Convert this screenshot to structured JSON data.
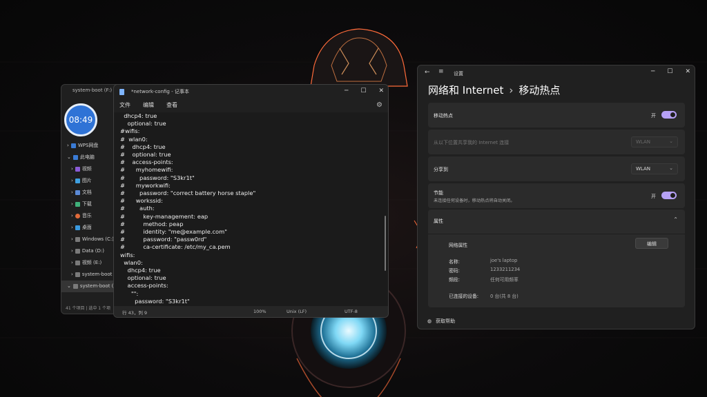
{
  "explorer": {
    "title": "system-boot (F:)",
    "nav_items": [
      {
        "label": "WPS网盘",
        "color": "#3a7bd5"
      },
      {
        "label": "此电脑",
        "color": "#3a7bd5"
      },
      {
        "label": "视频",
        "color": "#8a5bd6"
      },
      {
        "label": "图片",
        "color": "#3fa0e0"
      },
      {
        "label": "文档",
        "color": "#5b8ad6"
      },
      {
        "label": "下载",
        "color": "#3fb07a"
      },
      {
        "label": "音乐",
        "color": "#e06a3a"
      },
      {
        "label": "桌面",
        "color": "#3a9ae0"
      },
      {
        "label": "Windows (C:)",
        "color": "#7a7a7a"
      },
      {
        "label": "Data (D:)",
        "color": "#7a7a7a"
      },
      {
        "label": "视频 (E:)",
        "color": "#7a7a7a"
      },
      {
        "label": "system-boot (",
        "color": "#7a7a7a"
      },
      {
        "label": "system-boot (",
        "color": "#7a7a7a"
      }
    ],
    "status": "41 个项目 | 选中 1 个项"
  },
  "clock": {
    "time": "08:49"
  },
  "notepad": {
    "title": "*network-config - 记事本",
    "menu": [
      "文件",
      "编辑",
      "查看"
    ],
    "lines": [
      "  dhcp4: true",
      "    optional: true",
      "#wifis:",
      "#  wlan0:",
      "#    dhcp4: true",
      "#    optional: true",
      "#    access-points:",
      "#      myhomewifi:",
      "#        password: \"S3kr1t\"",
      "#      myworkwifi:",
      "#        password: \"correct battery horse staple\"",
      "#      workssid:",
      "#        auth:",
      "#          key-management: eap",
      "#          method: peap",
      "#          identity: \"me@example.com\"",
      "#          password: \"passw0rd\"",
      "#          ca-certificate: /etc/my_ca.pem",
      "wifis:",
      "  wlan0:",
      "    dhcp4: true",
      "    optional: true",
      "    access-points:",
      "      \"\":",
      "        password: \"S3kr1t\""
    ],
    "status": {
      "position": "行 43，列 9",
      "zoom": "100%",
      "eol": "Unix (LF)",
      "encoding": "UTF-8"
    }
  },
  "settings": {
    "app_label": "设置",
    "breadcrumb_parent": "网络和 Internet",
    "breadcrumb_current": "移动热点",
    "hotspot": {
      "label": "移动热点",
      "state": "开"
    },
    "share_from": {
      "label": "从以下位置共享我的 Internet 连接",
      "value": "WLAN"
    },
    "share_over": {
      "label": "分享到",
      "value": "WLAN"
    },
    "power_saving": {
      "label": "节能",
      "desc": "未连接任何设备时，移动热点将自动关闭。",
      "state": "开"
    },
    "properties": {
      "header": "属性",
      "net_props_label": "网络属性",
      "edit_button": "编辑",
      "name_label": "名称:",
      "name_value": "joe's laptop",
      "password_label": "密码:",
      "password_value": "1233211234",
      "band_label": "频段:",
      "band_value": "任何可用频率",
      "connected_label": "已连接的设备:",
      "connected_value": "0 台(共 8 台)"
    },
    "help": "获取帮助"
  }
}
